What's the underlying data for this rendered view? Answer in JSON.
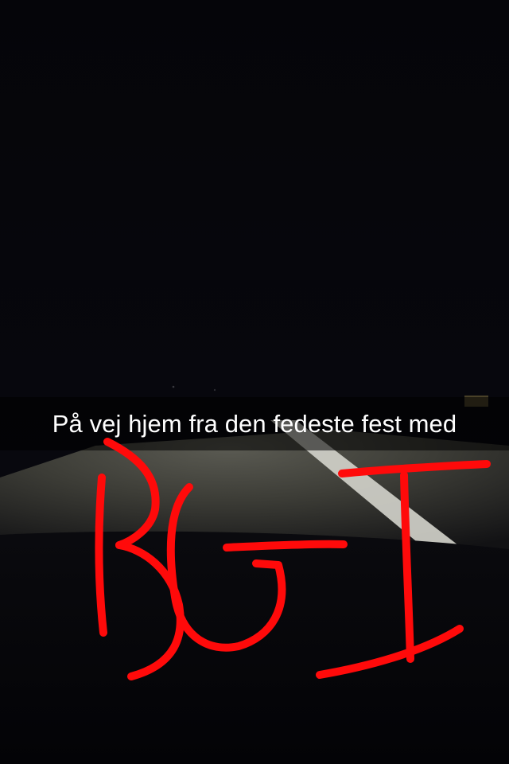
{
  "snap": {
    "caption": "På vej hjem fra den fedeste fest med"
  },
  "drawing": {
    "description_color": "#ff0a0a",
    "strokes": [
      "letter-b",
      "letter-g",
      "hyphen",
      "letter-i"
    ]
  },
  "colors": {
    "sky": "#06060c",
    "road": "#4a4a44",
    "lane_marking": "#d8d8d0",
    "caption_bar": "rgba(0,0,0,0.55)",
    "caption_text": "#ffffff",
    "drawing": "#ff0a0a"
  }
}
